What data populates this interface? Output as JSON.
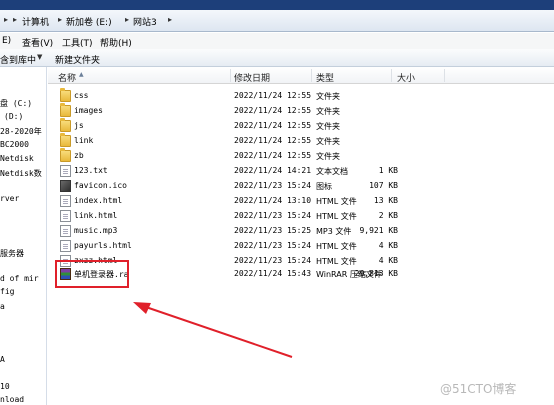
{
  "address": {
    "segments": [
      "计算机",
      "新加卷 (E:)",
      "网站3"
    ]
  },
  "menu": [
    "E)",
    "查看(V)",
    "工具(T)",
    "帮助(H)"
  ],
  "toolbar": {
    "include_library": "含到库中",
    "new_folder": "新建文件夹"
  },
  "nav": [
    "盘 (C:)",
    "(D:)",
    "28-2020年",
    "BC2000",
    "Netdisk",
    "Netdisk数",
    "rver",
    "服务器",
    "d of mir",
    "fig",
    "a",
    "A",
    "10",
    "nload"
  ],
  "columns": {
    "name": "名称",
    "date": "修改日期",
    "type": "类型",
    "size": "大小"
  },
  "files": [
    {
      "name": "css",
      "date": "2022/11/24 12:55",
      "type": "文件夹",
      "size": "",
      "icon": "folder-icon"
    },
    {
      "name": "images",
      "date": "2022/11/24 12:55",
      "type": "文件夹",
      "size": "",
      "icon": "folder-icon"
    },
    {
      "name": "js",
      "date": "2022/11/24 12:55",
      "type": "文件夹",
      "size": "",
      "icon": "folder-icon"
    },
    {
      "name": "link",
      "date": "2022/11/24 12:55",
      "type": "文件夹",
      "size": "",
      "icon": "folder-icon"
    },
    {
      "name": "zb",
      "date": "2022/11/24 12:55",
      "type": "文件夹",
      "size": "",
      "icon": "folder-icon"
    },
    {
      "name": "123.txt",
      "date": "2022/11/24 14:21",
      "type": "文本文档",
      "size": "1 KB",
      "icon": "text-file-icon"
    },
    {
      "name": "favicon.ico",
      "date": "2022/11/23 15:24",
      "type": "图标",
      "size": "107 KB",
      "icon": "image-icon"
    },
    {
      "name": "index.html",
      "date": "2022/11/24 13:10",
      "type": "HTML 文件",
      "size": "13 KB",
      "icon": "html-file-icon"
    },
    {
      "name": "link.html",
      "date": "2022/11/23 15:24",
      "type": "HTML 文件",
      "size": "2 KB",
      "icon": "html-file-icon"
    },
    {
      "name": "music.mp3",
      "date": "2022/11/23 15:25",
      "type": "MP3 文件",
      "size": "9,921 KB",
      "icon": "audio-file-icon"
    },
    {
      "name": "payurls.html",
      "date": "2022/11/23 15:24",
      "type": "HTML 文件",
      "size": "4 KB",
      "icon": "html-file-icon"
    },
    {
      "name": "zxzz.html",
      "date": "2022/11/23 15:24",
      "type": "HTML 文件",
      "size": "4 KB",
      "icon": "html-file-icon"
    },
    {
      "name": "单机登录器.ra",
      "date": "2022/11/24 15:43",
      "type": "WinRAR 压缩文件",
      "size": "29,813 KB",
      "icon": "rar-archive-icon"
    }
  ],
  "watermark": "@51CTO博客",
  "colors": {
    "annotation": "#e0202a",
    "titlebar": "#1d3f7a"
  }
}
